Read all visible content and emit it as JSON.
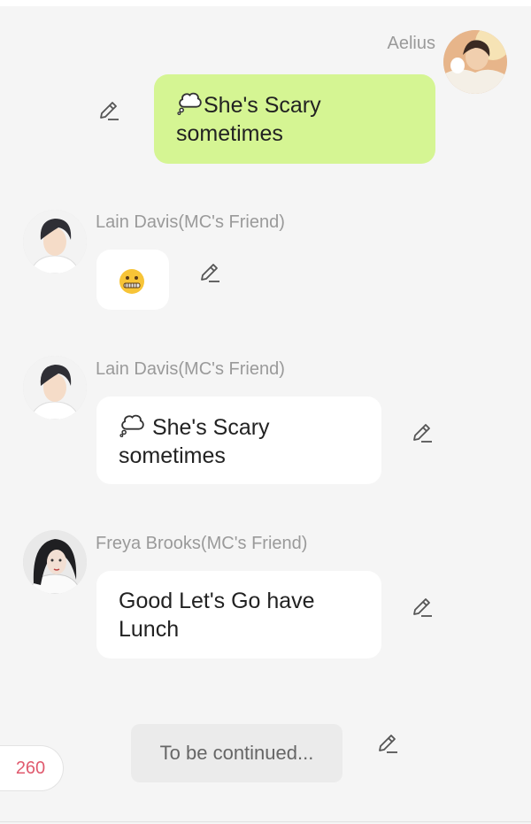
{
  "messages": [
    {
      "sender": "Aelius",
      "side": "right",
      "text": "She's Scary sometimes",
      "line1": "She's Scary",
      "line2": "sometimes",
      "bubble_color": "#d5f593",
      "prefix_icon": "thought-bubble-icon"
    },
    {
      "sender": "Lain Davis(MC's Friend)",
      "side": "left",
      "content_icon": "zipper-mouth-face-icon"
    },
    {
      "sender": "Lain Davis(MC's Friend)",
      "side": "left",
      "text": "She's Scary sometimes",
      "line1": " She's Scary",
      "line2": "sometimes",
      "prefix_icon": "thought-bubble-icon"
    },
    {
      "sender": "Freya Brooks(MC's Friend)",
      "side": "left",
      "text": "Good Let's Go have Lunch",
      "line1": "Good Let's Go have",
      "line2": "Lunch"
    }
  ],
  "status": {
    "continued_label": "To be continued...",
    "counter": "260",
    "counter_color": "#e05a6e"
  },
  "icons": {
    "edit": "pencil-edit-icon",
    "thought": "thought-bubble-icon"
  }
}
